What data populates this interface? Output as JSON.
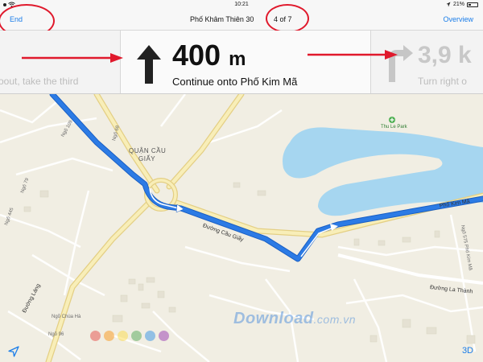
{
  "status_bar": {
    "time": "10:21",
    "battery": "21%"
  },
  "nav": {
    "end_label": "End",
    "route_title": "Phố Khâm Thiên 30",
    "step_indicator": "4 of 7",
    "overview_label": "Overview"
  },
  "instructions": {
    "previous": {
      "distance": "oout, take the third",
      "text": "oout, take the third"
    },
    "current": {
      "distance_value": "400",
      "distance_unit": "m",
      "text": "Continue onto Phố Kim Mã"
    },
    "next": {
      "distance": "3,9 k",
      "text": "Turn right o"
    }
  },
  "map": {
    "district_label": "QUẬN CẦU\nGIẤY",
    "district_line1": "QUẬN CẦU",
    "district_line2": "GIẤY",
    "park_name": "Thu Le Park",
    "streets": {
      "cau_giay": "Đường Cầu Giấy",
      "kim_ma": "Phố Kim Mã",
      "lang": "Đường Láng",
      "la_thanh": "Đường La Thành",
      "ngo_chua_ha": "Ngõ Chùa Hà",
      "ngo_575": "Ngõ 575 Phố Kim Mã",
      "ngo_109": "Ngõ 109",
      "ngo_68": "Ngõ 68",
      "ngo_79": "Ngõ 79",
      "ngo_445": "Ngõ 445",
      "ngo_96": "Ngõ 96"
    }
  },
  "watermark": {
    "brand": "Download",
    "domain": ".com.vn"
  },
  "controls": {
    "mode_3d_label": "3D"
  },
  "colors": {
    "route": "#2c7be5",
    "route_outline": "#1a5fc4",
    "water": "#a6d6f0",
    "major_road": "#f6e7a8",
    "annotation_red": "#e0192c",
    "accent_blue": "#1a7de9"
  }
}
